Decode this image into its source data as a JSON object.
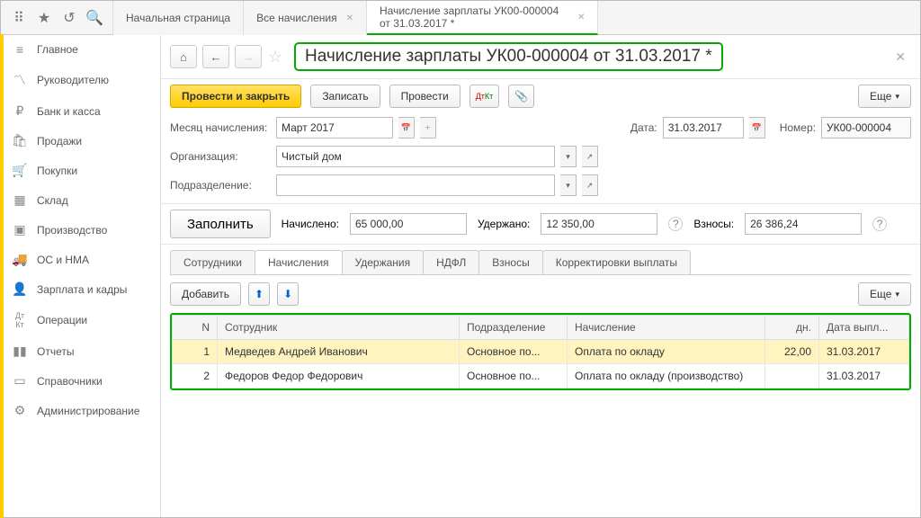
{
  "topbar": {
    "tabs": [
      {
        "label": "Начальная страница"
      },
      {
        "label": "Все начисления"
      },
      {
        "label": "Начисление зарплаты УК00-000004 от 31.03.2017 *",
        "active": true
      }
    ]
  },
  "sidebar": {
    "items": [
      {
        "icon": "≡",
        "label": "Главное"
      },
      {
        "icon": "📈",
        "label": "Руководителю"
      },
      {
        "icon": "₽",
        "label": "Банк и касса"
      },
      {
        "icon": "🛍",
        "label": "Продажи"
      },
      {
        "icon": "🛒",
        "label": "Покупки"
      },
      {
        "icon": "▦",
        "label": "Склад"
      },
      {
        "icon": "🏭",
        "label": "Производство"
      },
      {
        "icon": "🚚",
        "label": "ОС и НМА"
      },
      {
        "icon": "👤",
        "label": "Зарплата и кадры"
      },
      {
        "icon": "Дт",
        "label": "Операции"
      },
      {
        "icon": "📊",
        "label": "Отчеты"
      },
      {
        "icon": "📁",
        "label": "Справочники"
      },
      {
        "icon": "⚙",
        "label": "Администрирование"
      }
    ]
  },
  "doc": {
    "title": "Начисление зарплаты УК00-000004 от 31.03.2017 *",
    "buttons": {
      "post_close": "Провести и закрыть",
      "save": "Записать",
      "post": "Провести",
      "more": "Еще"
    },
    "fields": {
      "month_label": "Месяц начисления:",
      "month_value": "Март 2017",
      "date_label": "Дата:",
      "date_value": "31.03.2017",
      "number_label": "Номер:",
      "number_value": "УК00-000004",
      "org_label": "Организация:",
      "org_value": "Чистый дом",
      "dept_label": "Подразделение:",
      "dept_value": ""
    },
    "fill": {
      "button": "Заполнить",
      "accrued_label": "Начислено:",
      "accrued_value": "65 000,00",
      "withheld_label": "Удержано:",
      "withheld_value": "12 350,00",
      "contrib_label": "Взносы:",
      "contrib_value": "26 386,24"
    },
    "subtabs": {
      "t0": "Сотрудники",
      "t1": "Начисления",
      "t2": "Удержания",
      "t3": "НДФЛ",
      "t4": "Взносы",
      "t5": "Корректировки выплаты"
    },
    "table_actions": {
      "add": "Добавить",
      "more": "Еще"
    },
    "table": {
      "headers": {
        "n": "N",
        "employee": "Сотрудник",
        "dept": "Подразделение",
        "accrual": "Начисление",
        "days": "дн.",
        "paydate": "Дата выпл..."
      },
      "rows": [
        {
          "n": "1",
          "employee": "Медведев Андрей Иванович",
          "dept": "Основное по...",
          "accrual": "Оплата по окладу",
          "days": "22,00",
          "paydate": "31.03.2017",
          "selected": true
        },
        {
          "n": "2",
          "employee": "Федоров Федор Федорович",
          "dept": "Основное по...",
          "accrual": "Оплата по окладу (производство)",
          "days": "",
          "paydate": "31.03.2017",
          "selected": false
        }
      ]
    }
  }
}
